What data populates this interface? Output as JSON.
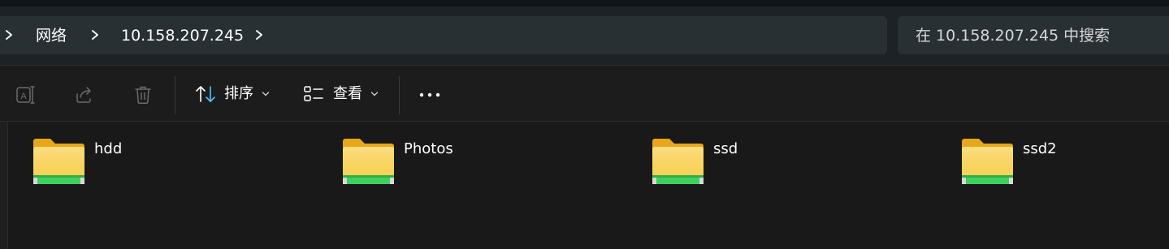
{
  "breadcrumb": {
    "items": [
      {
        "label": "网络"
      },
      {
        "label": "10.158.207.245"
      }
    ]
  },
  "search": {
    "placeholder": "在 10.158.207.245 中搜索"
  },
  "toolbar": {
    "rename_icon": "rename-icon",
    "share_icon": "share-icon",
    "delete_icon": "trash-icon",
    "sort_label": "排序",
    "view_label": "查看",
    "more_icon": "more-icon"
  },
  "folders": [
    {
      "name": "hdd"
    },
    {
      "name": "Photos"
    },
    {
      "name": "ssd"
    },
    {
      "name": "ssd2"
    }
  ],
  "colors": {
    "accent_blue": "#4cc2ff",
    "folder_yellow": "#f7cf55",
    "folder_green": "#3fcf5e"
  }
}
